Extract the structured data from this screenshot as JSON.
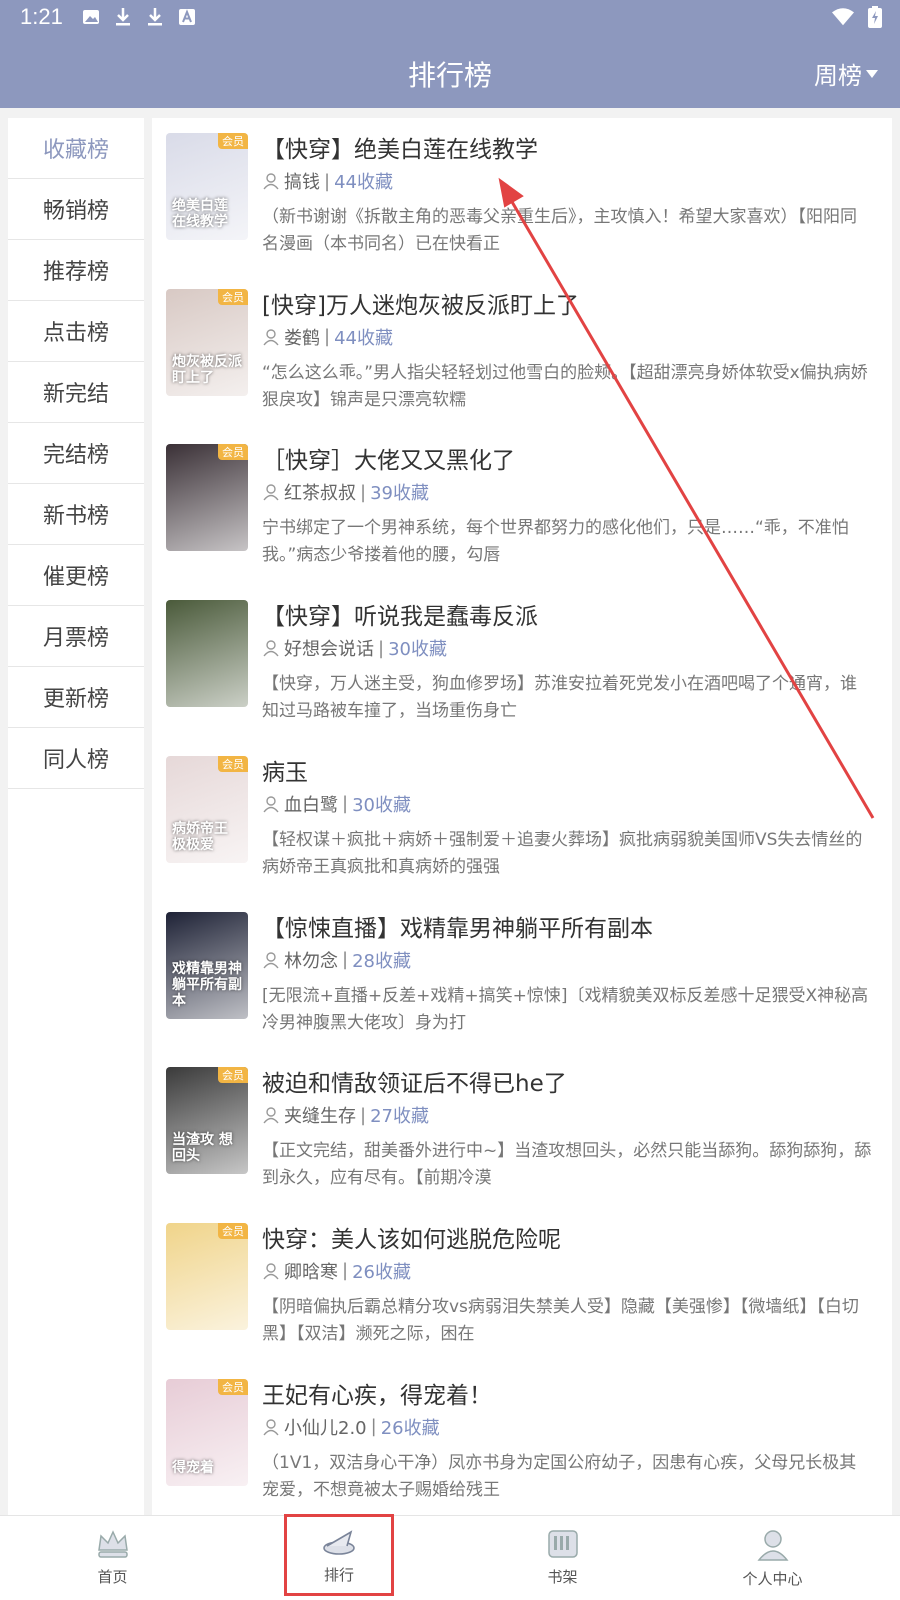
{
  "status_bar": {
    "time": "1:21",
    "left_icons": [
      "image-icon",
      "download-icon",
      "download-icon",
      "font-a-icon"
    ],
    "right_icons": [
      "wifi-icon",
      "battery-charging-icon"
    ]
  },
  "header": {
    "title": "排行榜",
    "period_label": "周榜",
    "bg_color": "#8d98be"
  },
  "sidebar": {
    "active_index": 0,
    "items": [
      {
        "label": "收藏榜"
      },
      {
        "label": "畅销榜"
      },
      {
        "label": "推荐榜"
      },
      {
        "label": "点击榜"
      },
      {
        "label": "新完结"
      },
      {
        "label": "完结榜"
      },
      {
        "label": "新书榜"
      },
      {
        "label": "催更榜"
      },
      {
        "label": "月票榜"
      },
      {
        "label": "更新榜"
      },
      {
        "label": "同人榜"
      }
    ]
  },
  "books": [
    {
      "title": "【快穿】绝美白莲在线教学",
      "author": "搞钱",
      "separator": "|",
      "favorites": "44收藏",
      "badge": "会员",
      "cover_text": "绝美白莲 在线教学",
      "description": "（新书谢谢《拆散主角的恶毒父亲重生后》，主攻慎入！希望大家喜欢）【阳阳同名漫画（本书同名）已在快看正"
    },
    {
      "title": "[快穿]万人迷炮灰被反派盯上了",
      "author": "娄鹤",
      "separator": "|",
      "favorites": "44收藏",
      "badge": "会员",
      "cover_text": "炮灰被反派 盯上了",
      "description": "“怎么这么乖。”男人指尖轻轻划过他雪白的脸颊。【超甜漂亮身娇体软受x偏执病娇狠戾攻】锦声是只漂亮软糯"
    },
    {
      "title": "［快穿］大佬又又黑化了",
      "author": "红茶叔叔",
      "separator": "|",
      "favorites": "39收藏",
      "badge": "会员",
      "cover_text": "",
      "description": "宁书绑定了一个男神系统，每个世界都努力的感化他们，只是……“乖，不准怕我。”病态少爷搂着他的腰，勾唇"
    },
    {
      "title": "【快穿】听说我是蠢毒反派",
      "author": "好想会说话",
      "separator": "|",
      "favorites": "30收藏",
      "badge": "",
      "cover_text": "",
      "description": "【快穿，万人迷主受，狗血修罗场】苏淮安拉着死党发小在酒吧喝了个通宵，谁知过马路被车撞了，当场重伤身亡"
    },
    {
      "title": "病玉",
      "author": "血白鹭",
      "separator": "|",
      "favorites": "30收藏",
      "badge": "会员",
      "cover_text": "病娇帝王 极极爱",
      "description": "【轻权谋＋疯批＋病娇＋强制爱＋追妻火葬场】疯批病弱貌美国师VS失去情丝的病娇帝王真疯批和真病娇的强强"
    },
    {
      "title": "【惊悚直播】戏精靠男神躺平所有副本",
      "author": "林勿念",
      "separator": "|",
      "favorites": "28收藏",
      "badge": "",
      "cover_text": "戏精靠男神 躺平所有副本",
      "description": "[无限流+直播+反差+戏精+搞笑+惊悚]〔戏精貌美双标反差感十足猥受X神秘高冷男神腹黑大佬攻〕身为打"
    },
    {
      "title": "被迫和情敌领证后不得已he了",
      "author": "夹缝生存",
      "separator": "|",
      "favorites": "27收藏",
      "badge": "会员",
      "cover_text": "当渣攻 想回头",
      "description": "【正文完结，甜美番外进行中~】当渣攻想回头，必然只能当舔狗。舔狗舔狗，舔到永久，应有尽有。【前期冷漠"
    },
    {
      "title": "快穿：美人该如何逃脱危险呢",
      "author": "卿晗寒",
      "separator": "|",
      "favorites": "26收藏",
      "badge": "会员",
      "cover_text": "",
      "description": "【阴暗偏执后霸总精分攻vs病弱泪失禁美人受】隐藏【美强惨】【微墙纸】【白切黑】【双洁】濒死之际，困在"
    },
    {
      "title": "王妃有心疾，得宠着！",
      "author": "小仙儿2.0",
      "separator": "|",
      "favorites": "26收藏",
      "badge": "会员",
      "cover_text": "得宠着",
      "description": "（1V1，双洁身心干净）凤亦书身为定国公府幼子，因患有心疾，父母兄长极其宠爱，不想竟被太子赐婚给残王"
    }
  ],
  "cover_colors": [
    "#d9dbe8",
    "#d8c9c4",
    "#3a3036",
    "#4a5a3a",
    "#e6d8d8",
    "#1e2236",
    "#3a3a3a",
    "#f0d48a",
    "#e7ccd6"
  ],
  "tabs": [
    {
      "label": "首页",
      "icon": "crown-icon"
    },
    {
      "label": "排行",
      "icon": "ranking-hat-icon"
    },
    {
      "label": "书架",
      "icon": "bookshelf-icon"
    },
    {
      "label": "个人中心",
      "icon": "user-profile-icon"
    }
  ],
  "accent_color": "#7f8fc0",
  "annotation_color": "#e24343"
}
